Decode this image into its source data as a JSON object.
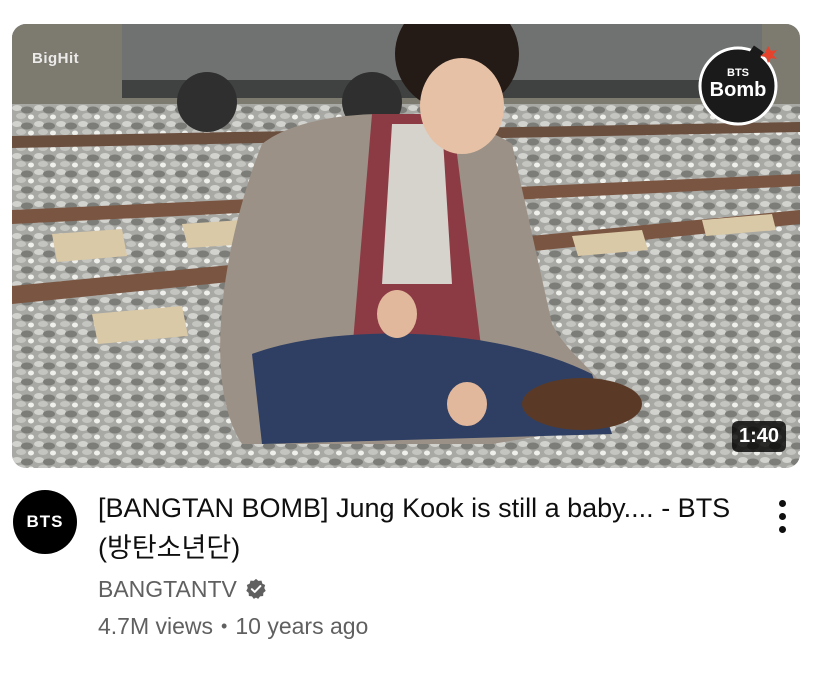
{
  "video": {
    "title": "[BANGTAN BOMB] Jung Kook is still a baby.... - BTS (방탄소년단)",
    "duration": "1:40",
    "thumbnail_watermark": "BigHit",
    "thumbnail_logo": {
      "line1": "BTS",
      "line2": "Bomb"
    }
  },
  "channel": {
    "name": "BANGTANTV",
    "avatar_text": "BTS",
    "verified": true
  },
  "stats": {
    "views": "4.7M views",
    "separator": "•",
    "age": "10 years ago"
  },
  "icons": {
    "menu": "more-vert-icon",
    "verified": "verified-badge-icon"
  }
}
